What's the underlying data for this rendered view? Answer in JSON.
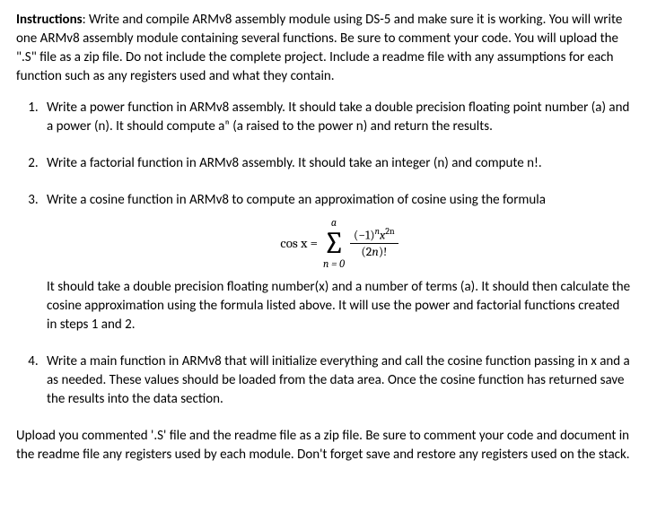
{
  "intro": {
    "label": "Instructions",
    "text": ": Write and compile ARMv8 assembly module using DS-5 and make sure it is working. You will write one ARMv8 assembly module containing several functions. Be sure to comment your code. You will upload the \".S\" file as a zip file. Do not include the complete project. Include a readme file with any assumptions for each function such as any registers used and what they contain."
  },
  "items": {
    "q1": "Write a power function in ARMv8 assembly. It should take a double precision floating point number (a) and a power (n). It should compute aⁿ (a raised to the power n) and return the results.",
    "q2": "Write a factorial function in ARMv8 assembly. It should take an integer (n) and compute n!.",
    "q3a": "Write a cosine function in ARMv8 to compute an approximation of cosine using the formula",
    "q3b": "It should take a double precision floating number(x) and a number of terms (a). It should then calculate the cosine approximation using the formula listed above. It will use the power and factorial functions created in steps 1 and 2.",
    "q4": "Write a main function in ARMv8 that will initialize everything and call the cosine function passing in x and a as needed. These values should be loaded from the data area. Once the cosine function has returned save the results into the data section."
  },
  "formula": {
    "lhs": "cos x =",
    "upper": "a",
    "lower": "n = 0",
    "num_minus1": "(−1)",
    "num_exp1": "n",
    "num_x": "x",
    "num_exp2": "2n",
    "den_open": "(2",
    "den_n": "n",
    "den_close": ")!"
  },
  "closing": "Upload you commented '.S' file and the readme file as a zip file. Be sure to comment your code and document in the readme file any registers used by each module. Don't forget save and restore any registers used on the stack."
}
